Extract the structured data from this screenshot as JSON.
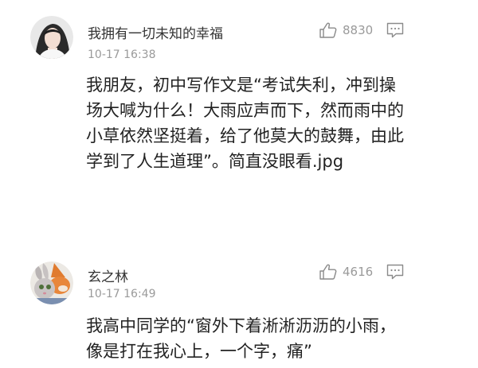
{
  "comments": [
    {
      "username": "我拥有一切未知的幸福",
      "time": "10-17 16:38",
      "likes": "8830",
      "text": "我朋友，初中写作文是“考试失利，冲到操场大喊为什么！大雨应声而下，然而雨中的小草依然坚挺着，给了他莫大的鼓舞，由此学到了人生道理”。简直没眼看.jpg",
      "avatar_icon": "girl-portrait-avatar"
    },
    {
      "username": "玄之林",
      "time": "10-17 16:49",
      "likes": "4616",
      "text": "我高中同学的“窗外下着淅淅沥沥的小雨，像是打在我心上，一个字，痛”",
      "avatar_icon": "fox-rabbit-avatar"
    }
  ],
  "icons": {
    "like": "thumbs-up-icon",
    "reply": "comment-bubble-icon"
  },
  "colors": {
    "username": "#333333",
    "meta": "#9a9a9a",
    "body": "#222222",
    "icon": "#8a8a8a"
  }
}
